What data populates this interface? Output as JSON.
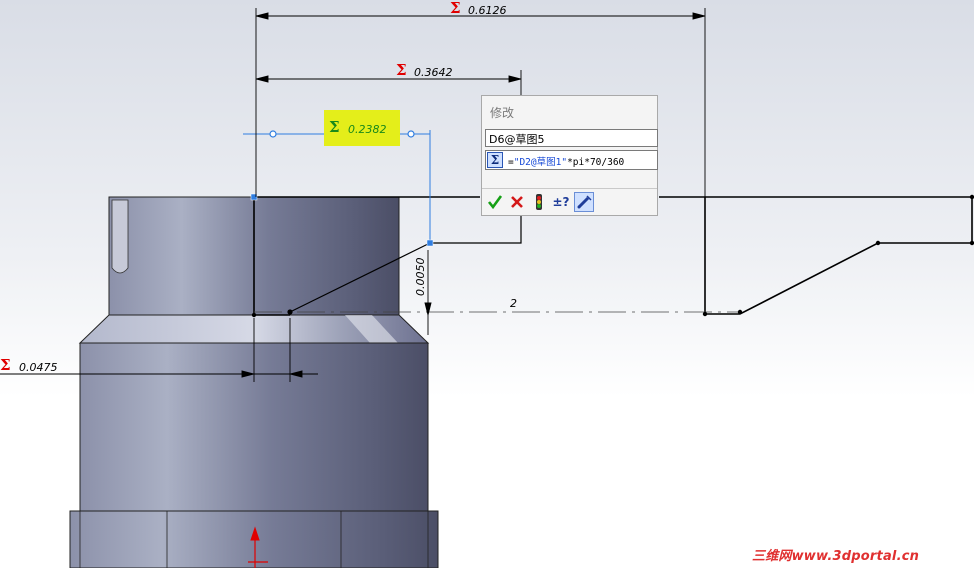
{
  "dimensions": {
    "overall_width": "0.6126",
    "mid_width": "0.3642",
    "selected_width": "0.2382",
    "left_offset": "0.0475",
    "vertical_height": "0.0050",
    "angle_label": "2"
  },
  "modify_dialog": {
    "title": "修改",
    "dimension_name": "D6@草图5",
    "equation_prefix": "=",
    "equation_ref": "\"D2@草图1\"",
    "equation_suffix": "*pi*70/360",
    "sigma_button": "Σ"
  },
  "toolbar": {
    "ok_icon": "checkmark-icon",
    "cancel_icon": "x-icon",
    "rebuild_icon": "traffic-light-icon",
    "reverse_label": "±?",
    "mark_icon": "pencil-mark-icon"
  },
  "sigma_symbol": "Σ",
  "colors": {
    "sigma_red": "#e00000",
    "highlight": "#e4ee1a",
    "selection_blue": "#2f7de0",
    "part_body": "#6f7391"
  },
  "watermark": "三维网www.3dportal.cn"
}
